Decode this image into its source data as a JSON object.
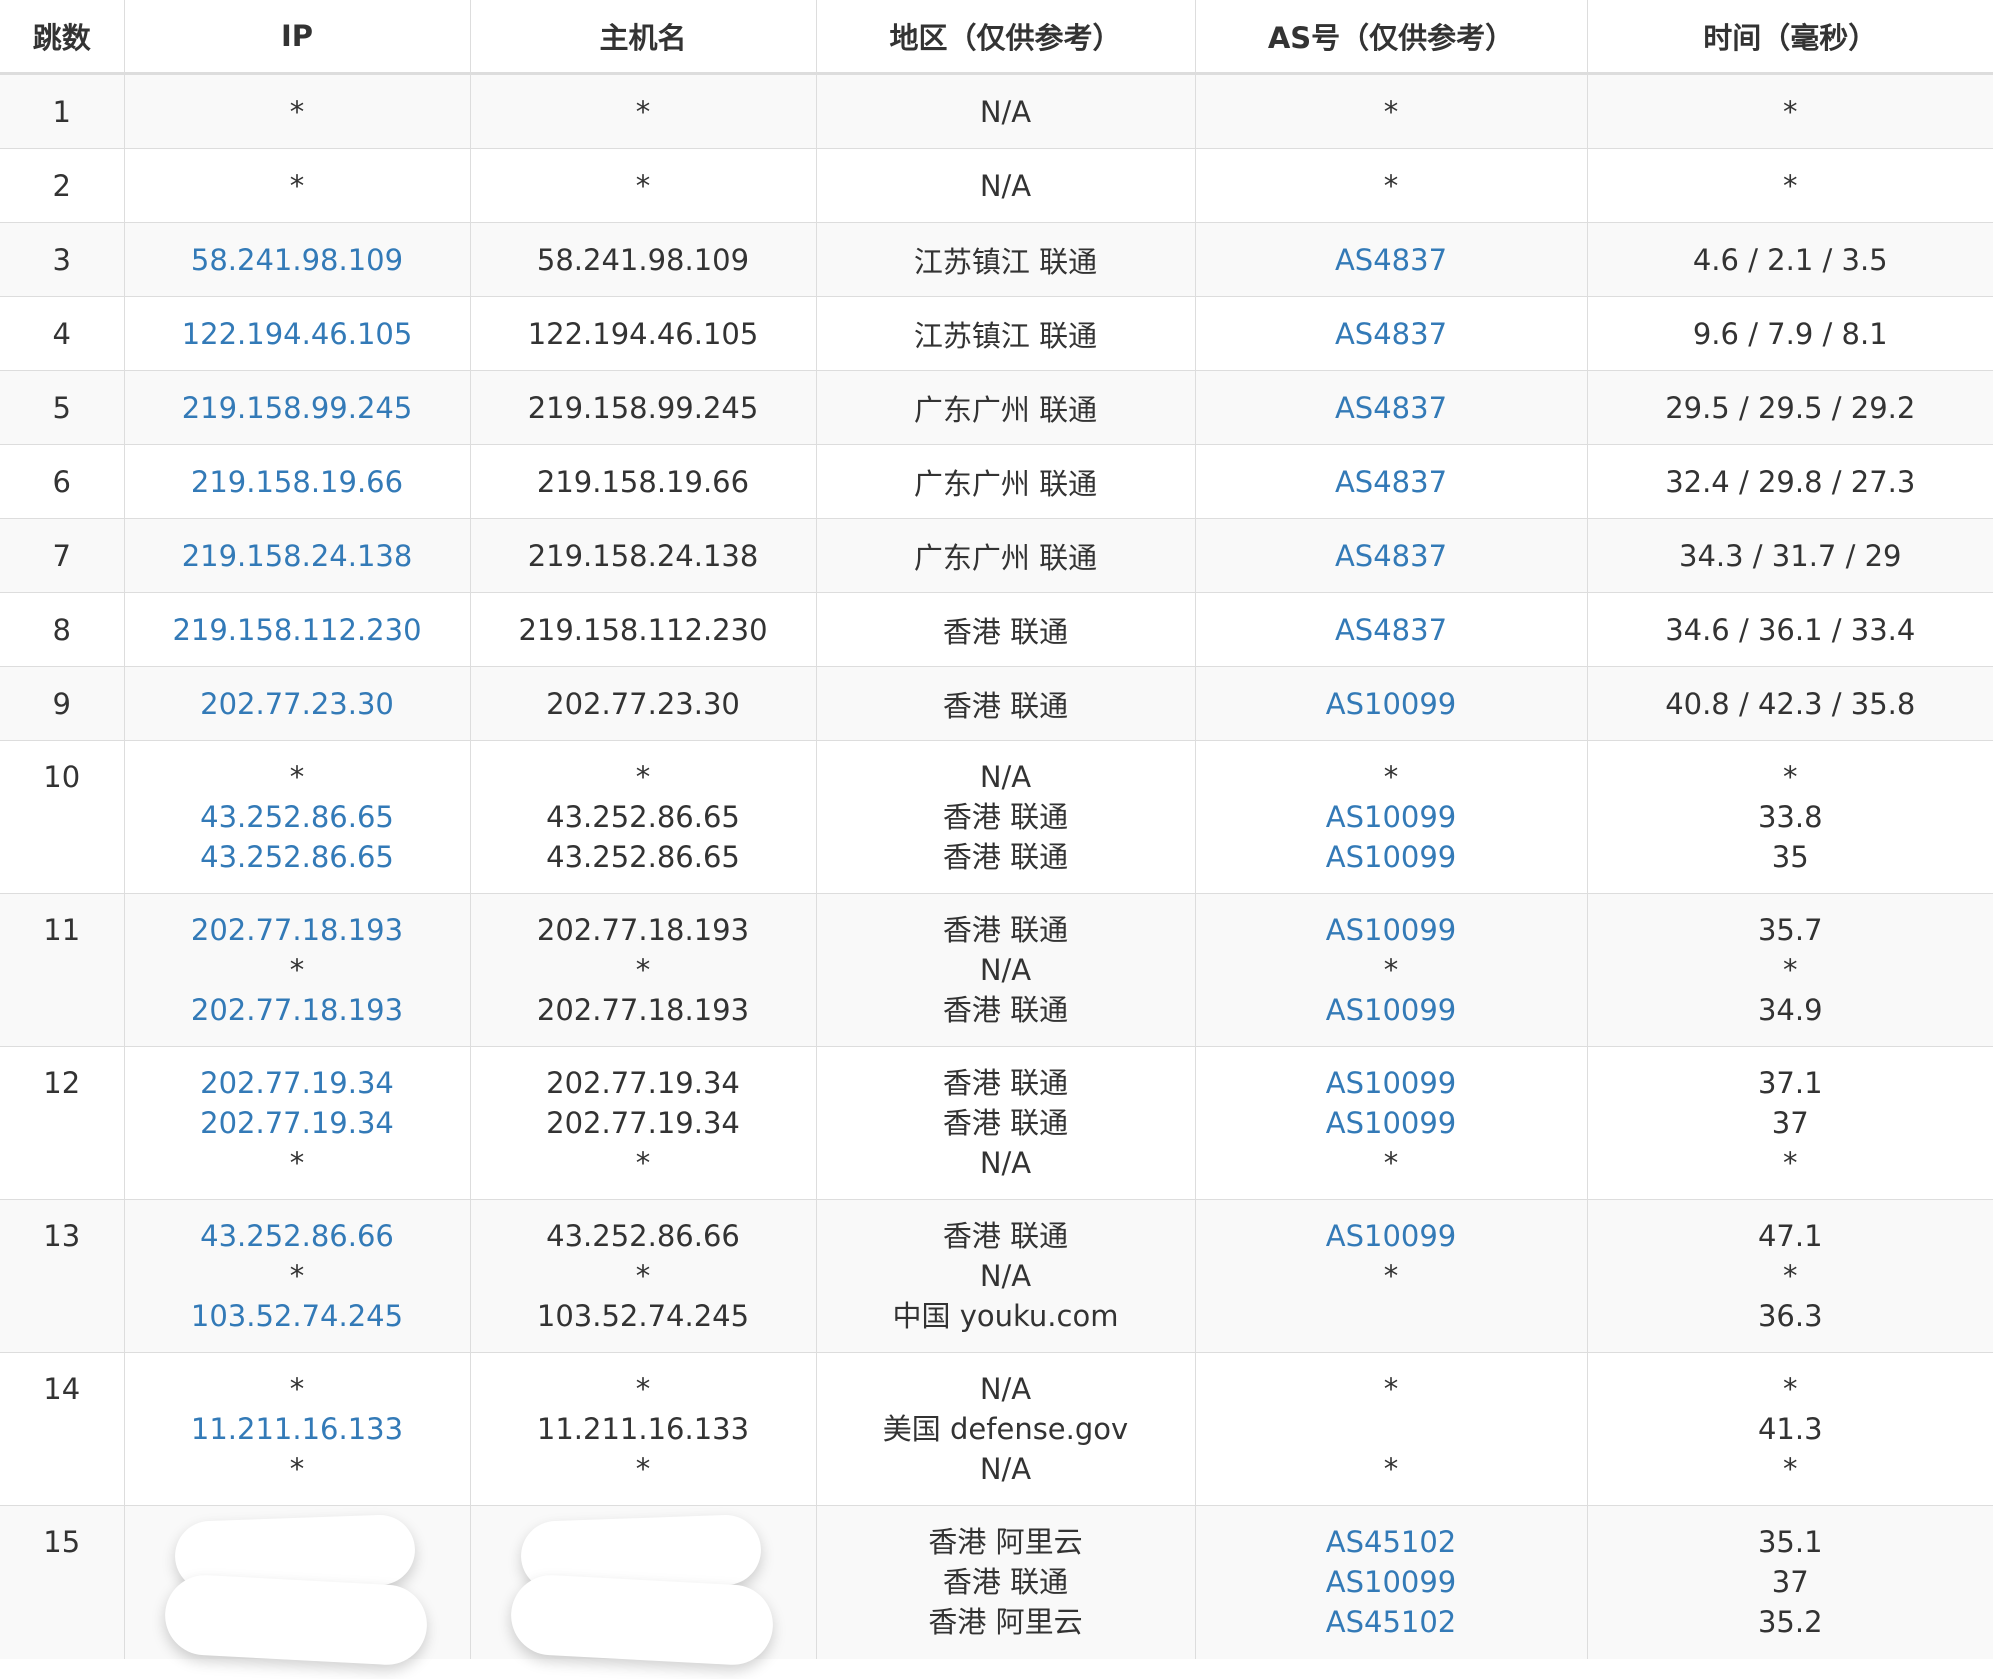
{
  "headers": {
    "hop": "跳数",
    "ip": "IP",
    "host": "主机名",
    "region": "地区（仅供参考）",
    "as": "AS号（仅供参考）",
    "time": "时间（毫秒）"
  },
  "rows": [
    {
      "hop": "1",
      "ip": [
        "*"
      ],
      "host": [
        "*"
      ],
      "region": [
        "N/A"
      ],
      "as": [
        "*"
      ],
      "time": [
        "*"
      ]
    },
    {
      "hop": "2",
      "ip": [
        "*"
      ],
      "host": [
        "*"
      ],
      "region": [
        "N/A"
      ],
      "as": [
        "*"
      ],
      "time": [
        "*"
      ]
    },
    {
      "hop": "3",
      "ip": [
        "58.241.98.109"
      ],
      "host": [
        "58.241.98.109"
      ],
      "region": [
        "江苏镇江 联通"
      ],
      "as": [
        "AS4837"
      ],
      "time": [
        "4.6 / 2.1 / 3.5"
      ]
    },
    {
      "hop": "4",
      "ip": [
        "122.194.46.105"
      ],
      "host": [
        "122.194.46.105"
      ],
      "region": [
        "江苏镇江 联通"
      ],
      "as": [
        "AS4837"
      ],
      "time": [
        "9.6 / 7.9 / 8.1"
      ]
    },
    {
      "hop": "5",
      "ip": [
        "219.158.99.245"
      ],
      "host": [
        "219.158.99.245"
      ],
      "region": [
        "广东广州 联通"
      ],
      "as": [
        "AS4837"
      ],
      "time": [
        "29.5 / 29.5 / 29.2"
      ]
    },
    {
      "hop": "6",
      "ip": [
        "219.158.19.66"
      ],
      "host": [
        "219.158.19.66"
      ],
      "region": [
        "广东广州 联通"
      ],
      "as": [
        "AS4837"
      ],
      "time": [
        "32.4 / 29.8 / 27.3"
      ]
    },
    {
      "hop": "7",
      "ip": [
        "219.158.24.138"
      ],
      "host": [
        "219.158.24.138"
      ],
      "region": [
        "广东广州 联通"
      ],
      "as": [
        "AS4837"
      ],
      "time": [
        "34.3 / 31.7 / 29"
      ]
    },
    {
      "hop": "8",
      "ip": [
        "219.158.112.230"
      ],
      "host": [
        "219.158.112.230"
      ],
      "region": [
        "香港 联通"
      ],
      "as": [
        "AS4837"
      ],
      "time": [
        "34.6 / 36.1 / 33.4"
      ]
    },
    {
      "hop": "9",
      "ip": [
        "202.77.23.30"
      ],
      "host": [
        "202.77.23.30"
      ],
      "region": [
        "香港 联通"
      ],
      "as": [
        "AS10099"
      ],
      "time": [
        "40.8 / 42.3 / 35.8"
      ]
    },
    {
      "hop": "10",
      "ip": [
        "*",
        "43.252.86.65",
        "43.252.86.65"
      ],
      "host": [
        "*",
        "43.252.86.65",
        "43.252.86.65"
      ],
      "region": [
        "N/A",
        "香港 联通",
        "香港 联通"
      ],
      "as": [
        "*",
        "AS10099",
        "AS10099"
      ],
      "time": [
        "*",
        "33.8",
        "35"
      ]
    },
    {
      "hop": "11",
      "ip": [
        "202.77.18.193",
        "*",
        "202.77.18.193"
      ],
      "host": [
        "202.77.18.193",
        "*",
        "202.77.18.193"
      ],
      "region": [
        "香港 联通",
        "N/A",
        "香港 联通"
      ],
      "as": [
        "AS10099",
        "*",
        "AS10099"
      ],
      "time": [
        "35.7",
        "*",
        "34.9"
      ]
    },
    {
      "hop": "12",
      "ip": [
        "202.77.19.34",
        "202.77.19.34",
        "*"
      ],
      "host": [
        "202.77.19.34",
        "202.77.19.34",
        "*"
      ],
      "region": [
        "香港 联通",
        "香港 联通",
        "N/A"
      ],
      "as": [
        "AS10099",
        "AS10099",
        "*"
      ],
      "time": [
        "37.1",
        "37",
        "*"
      ]
    },
    {
      "hop": "13",
      "ip": [
        "43.252.86.66",
        "*",
        "103.52.74.245"
      ],
      "host": [
        "43.252.86.66",
        "*",
        "103.52.74.245"
      ],
      "region": [
        "香港 联通",
        "N/A",
        "中国 youku.com"
      ],
      "as": [
        "AS10099",
        "*",
        ""
      ],
      "time": [
        "47.1",
        "*",
        "36.3"
      ]
    },
    {
      "hop": "14",
      "ip": [
        "*",
        "11.211.16.133",
        "*"
      ],
      "host": [
        "*",
        "11.211.16.133",
        "*"
      ],
      "region": [
        "N/A",
        "美国 defense.gov",
        "N/A"
      ],
      "as": [
        "*",
        "",
        "*"
      ],
      "time": [
        "*",
        "41.3",
        "*"
      ]
    },
    {
      "hop": "15",
      "ip": [],
      "host": [],
      "region": [
        "香港 阿里云",
        "香港 联通",
        "香港 阿里云"
      ],
      "as": [
        "AS45102",
        "AS10099",
        "AS45102"
      ],
      "time": [
        "35.1",
        "37",
        "35.2"
      ]
    }
  ]
}
